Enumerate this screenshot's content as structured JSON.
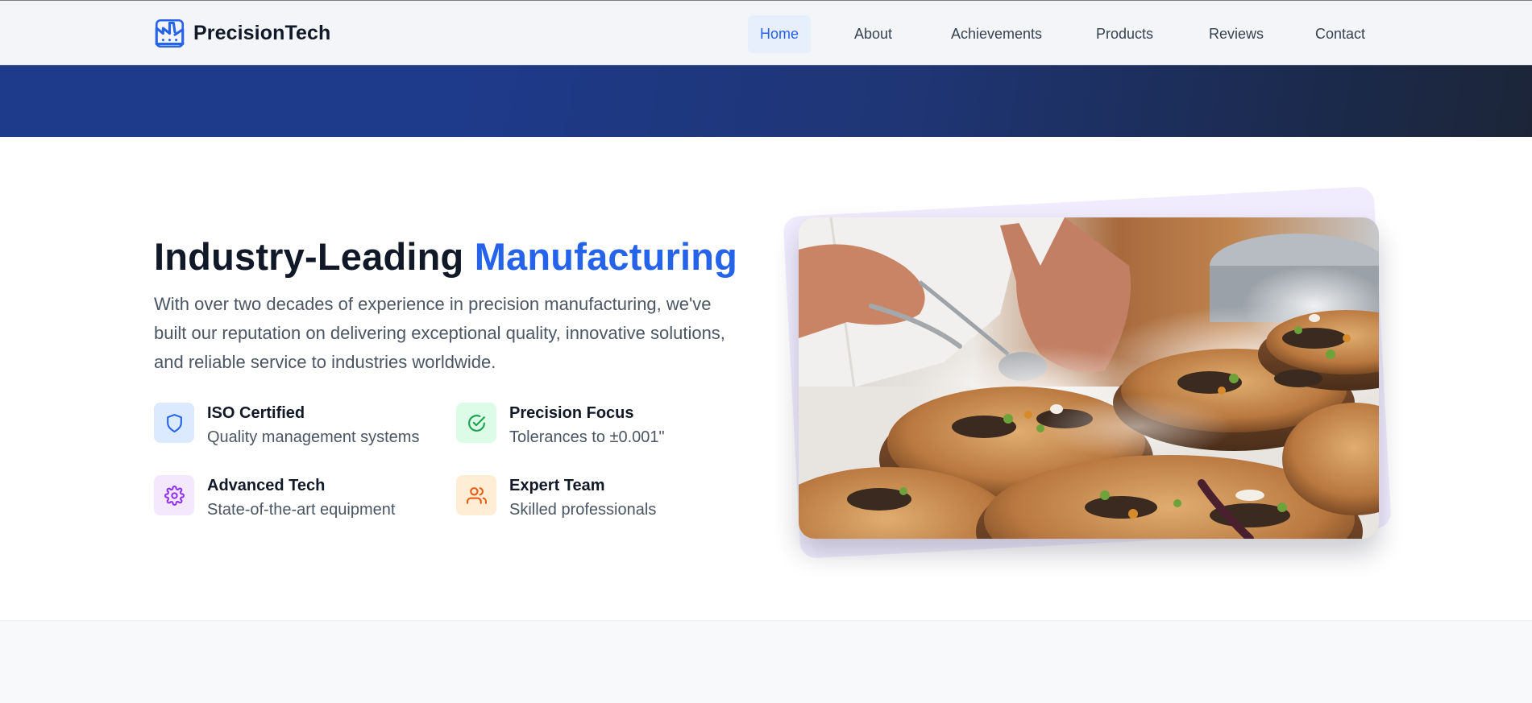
{
  "brand": {
    "name": "PrecisionTech",
    "logo_icon": "factory-icon",
    "accent": "#2563eb"
  },
  "nav": {
    "active": "Home",
    "items": [
      {
        "label": "Home"
      },
      {
        "label": "About"
      },
      {
        "label": "Achievements"
      },
      {
        "label": "Products"
      },
      {
        "label": "Reviews"
      },
      {
        "label": "Contact"
      }
    ]
  },
  "about": {
    "heading_plain": "Industry-Leading",
    "heading_accent": "Manufacturing",
    "intro": "With over two decades of experience in precision manufacturing, we've built our reputation on delivering exceptional quality, innovative solutions, and reliable service to industries worldwide.",
    "features": [
      {
        "title": "ISO Certified",
        "desc": "Quality management systems",
        "icon": "shield-icon",
        "color": "#2563eb",
        "bg": "#dbeafe"
      },
      {
        "title": "Precision Focus",
        "desc": "Tolerances to ±0.001\"",
        "icon": "check-circle-icon",
        "color": "#16a34a",
        "bg": "#dcfce7"
      },
      {
        "title": "Advanced Tech",
        "desc": "State-of-the-art equipment",
        "icon": "gear-icon",
        "color": "#9333ea",
        "bg": "#f3e8ff"
      },
      {
        "title": "Expert Team",
        "desc": "Skilled professionals",
        "icon": "users-icon",
        "color": "#ea580c",
        "bg": "#ffedd5"
      }
    ]
  },
  "colors": {
    "hero_band": "#1e3a8a",
    "heading": "#111827",
    "body_text": "#4b5563"
  }
}
